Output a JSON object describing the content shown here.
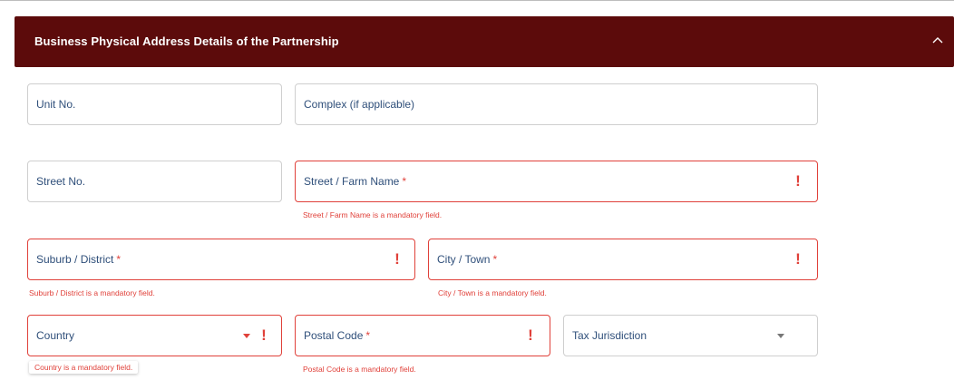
{
  "section": {
    "title": "Business Physical Address Details of the Partnership"
  },
  "fields": {
    "unit_no": {
      "label": "Unit No."
    },
    "complex": {
      "label": "Complex (if applicable)"
    },
    "street_no": {
      "label": "Street No."
    },
    "street_name": {
      "label": "Street / Farm Name",
      "required_mark": "*",
      "error": "Street / Farm Name is a mandatory field."
    },
    "suburb": {
      "label": "Suburb / District",
      "required_mark": "*",
      "error": "Suburb / District is a mandatory field."
    },
    "city": {
      "label": "City / Town",
      "required_mark": "*",
      "error": "City / Town is a mandatory field."
    },
    "country": {
      "label": "Country",
      "error": "Country is a mandatory field."
    },
    "postal_code": {
      "label": "Postal Code",
      "required_mark": "*",
      "error": "Postal Code is a mandatory field."
    },
    "tax_jurisdiction": {
      "label": "Tax Jurisdiction"
    }
  },
  "icons": {
    "error": "exclamation-icon",
    "dropdown": "caret-down-icon",
    "collapse": "chevron-up-icon"
  },
  "colors": {
    "header_bg": "#5c0b0b",
    "error": "#e0413a",
    "label": "#2f4f7a"
  }
}
